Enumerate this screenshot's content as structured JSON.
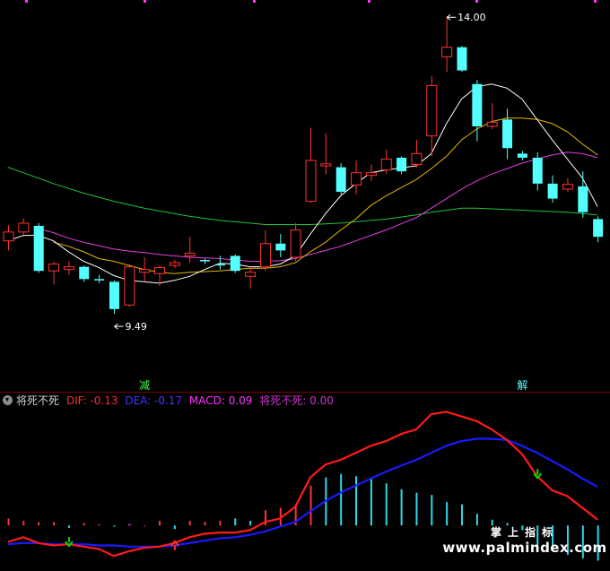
{
  "colors": {
    "background": "#000000",
    "up_candle": "#ff3333",
    "down_candle": "#54ffff",
    "ma_white": "#ffffff",
    "ma_yellow": "#e6b800",
    "ma_magenta": "#e040e0",
    "ma_green": "#1fc43a",
    "dif": "#ff1a1a",
    "dea": "#1a1aff",
    "macd_label": "#ff33ff",
    "signal_label": "#cc33cc",
    "hist_pos": "#ff3333",
    "hist_neg": "#30d8e8",
    "hist_mag": "#ff33ff",
    "arrow_green": "#00e000",
    "arrow_red": "#ff3333",
    "separator": "#7a0000",
    "top_ticks": "#ff33ff"
  },
  "chart_data": [
    {
      "type": "candlestick",
      "price_range": [
        8.6,
        14.2
      ],
      "candles": [
        {
          "o": 10.72,
          "h": 10.95,
          "l": 10.58,
          "c": 10.85
        },
        {
          "o": 10.85,
          "h": 11.05,
          "l": 10.78,
          "c": 10.98
        },
        {
          "o": 10.94,
          "h": 10.98,
          "l": 10.25,
          "c": 10.28
        },
        {
          "o": 10.28,
          "h": 10.42,
          "l": 10.08,
          "c": 10.38
        },
        {
          "o": 10.3,
          "h": 10.42,
          "l": 10.22,
          "c": 10.34
        },
        {
          "o": 10.34,
          "h": 10.36,
          "l": 10.12,
          "c": 10.16
        },
        {
          "o": 10.16,
          "h": 10.22,
          "l": 10.1,
          "c": 10.14
        },
        {
          "o": 10.12,
          "h": 10.14,
          "l": 9.65,
          "c": 9.72
        },
        {
          "o": 9.78,
          "h": 10.38,
          "l": 9.75,
          "c": 10.34
        },
        {
          "o": 10.26,
          "h": 10.48,
          "l": 10.12,
          "c": 10.3
        },
        {
          "o": 10.24,
          "h": 10.36,
          "l": 10.06,
          "c": 10.33
        },
        {
          "o": 10.36,
          "h": 10.44,
          "l": 10.32,
          "c": 10.4
        },
        {
          "o": 10.5,
          "h": 10.78,
          "l": 10.4,
          "c": 10.54
        },
        {
          "o": 10.44,
          "h": 10.46,
          "l": 10.38,
          "c": 10.42
        },
        {
          "o": 10.38,
          "h": 10.5,
          "l": 10.3,
          "c": 10.36
        },
        {
          "o": 10.5,
          "h": 10.52,
          "l": 10.25,
          "c": 10.28
        },
        {
          "o": 10.2,
          "h": 10.34,
          "l": 10.02,
          "c": 10.26
        },
        {
          "o": 10.34,
          "h": 10.88,
          "l": 10.28,
          "c": 10.68
        },
        {
          "o": 10.68,
          "h": 10.82,
          "l": 10.48,
          "c": 10.58
        },
        {
          "o": 10.48,
          "h": 10.98,
          "l": 10.42,
          "c": 10.88
        },
        {
          "o": 11.3,
          "h": 12.38,
          "l": 11.28,
          "c": 11.9
        },
        {
          "o": 11.82,
          "h": 12.3,
          "l": 11.7,
          "c": 11.85
        },
        {
          "o": 11.8,
          "h": 11.86,
          "l": 11.4,
          "c": 11.44
        },
        {
          "o": 11.54,
          "h": 11.9,
          "l": 11.4,
          "c": 11.72
        },
        {
          "o": 11.68,
          "h": 11.84,
          "l": 11.6,
          "c": 11.72
        },
        {
          "o": 11.76,
          "h": 12.06,
          "l": 11.7,
          "c": 11.92
        },
        {
          "o": 11.94,
          "h": 11.96,
          "l": 11.7,
          "c": 11.74
        },
        {
          "o": 11.84,
          "h": 12.2,
          "l": 11.8,
          "c": 12.0
        },
        {
          "o": 12.26,
          "h": 13.14,
          "l": 11.96,
          "c": 13.0
        },
        {
          "o": 13.42,
          "h": 14.0,
          "l": 13.2,
          "c": 13.56
        },
        {
          "o": 13.56,
          "h": 13.58,
          "l": 13.2,
          "c": 13.22
        },
        {
          "o": 13.02,
          "h": 13.08,
          "l": 12.18,
          "c": 12.4
        },
        {
          "o": 12.4,
          "h": 12.74,
          "l": 12.36,
          "c": 12.46
        },
        {
          "o": 12.5,
          "h": 12.66,
          "l": 11.92,
          "c": 12.08
        },
        {
          "o": 12.0,
          "h": 12.04,
          "l": 11.9,
          "c": 11.94
        },
        {
          "o": 11.94,
          "h": 12.02,
          "l": 11.46,
          "c": 11.56
        },
        {
          "o": 11.56,
          "h": 11.68,
          "l": 11.28,
          "c": 11.34
        },
        {
          "o": 11.48,
          "h": 11.64,
          "l": 11.44,
          "c": 11.55
        },
        {
          "o": 11.52,
          "h": 11.74,
          "l": 11.06,
          "c": 11.14
        },
        {
          "o": 11.04,
          "h": 11.08,
          "l": 10.7,
          "c": 10.78
        }
      ],
      "ma_white": [
        10.72,
        10.8,
        10.8,
        10.72,
        10.56,
        10.42,
        10.33,
        10.21,
        10.14,
        10.12,
        10.1,
        10.14,
        10.2,
        10.3,
        10.39,
        10.38,
        10.34,
        10.34,
        10.38,
        10.5,
        10.82,
        11.12,
        11.38,
        11.56,
        11.72,
        11.76,
        11.79,
        11.82,
        12.0,
        12.44,
        12.8,
        12.98,
        13.02,
        12.96,
        12.8,
        12.5,
        12.2,
        11.92,
        11.64,
        11.22
      ],
      "ma_yellow": [
        null,
        null,
        null,
        10.7,
        10.64,
        10.56,
        10.46,
        10.42,
        10.36,
        10.3,
        10.26,
        10.24,
        10.26,
        10.27,
        10.28,
        10.3,
        10.32,
        10.32,
        10.34,
        10.4,
        10.56,
        10.7,
        10.88,
        11.04,
        11.24,
        11.38,
        11.5,
        11.62,
        11.78,
        11.96,
        12.2,
        12.36,
        12.47,
        12.52,
        12.52,
        12.5,
        12.44,
        12.32,
        12.14,
        11.98
      ],
      "ma_magenta": [
        null,
        null,
        10.9,
        10.84,
        10.76,
        10.7,
        10.65,
        10.6,
        10.57,
        10.55,
        10.52,
        10.5,
        10.48,
        10.47,
        10.46,
        10.44,
        10.42,
        10.42,
        10.43,
        10.46,
        10.52,
        10.58,
        10.64,
        10.72,
        10.8,
        10.88,
        10.97,
        11.06,
        11.2,
        11.34,
        11.48,
        11.6,
        11.7,
        11.78,
        11.86,
        11.92,
        11.98,
        12.02,
        12.0,
        11.94
      ],
      "ma_green": [
        11.8,
        11.72,
        11.64,
        11.56,
        11.49,
        11.42,
        11.36,
        11.3,
        11.25,
        11.2,
        11.16,
        11.12,
        11.08,
        11.05,
        11.02,
        11.0,
        10.98,
        10.96,
        10.96,
        10.96,
        10.96,
        10.97,
        10.98,
        11.0,
        11.02,
        11.04,
        11.07,
        11.1,
        11.14,
        11.17,
        11.2,
        11.2,
        11.19,
        11.18,
        11.17,
        11.16,
        11.15,
        11.14,
        11.12,
        11.1
      ],
      "high_marker": {
        "index": 29,
        "label": "14.00"
      },
      "low_marker": {
        "index": 7,
        "label": "9.49"
      },
      "signals": [
        {
          "index": 9,
          "label": "减",
          "color": "#40ff40"
        },
        {
          "index": 34,
          "label": "解",
          "color": "#54ffff"
        }
      ]
    },
    {
      "type": "macd",
      "value_range": [
        -0.35,
        0.95
      ],
      "indicator_name": "将死不死",
      "dif_label": "DIF: -0.13",
      "dea_label": "DEA: -0.17",
      "macd_label": "MACD: 0.09",
      "signal_label": "将死不死: 0.00",
      "dif": [
        -0.14,
        -0.1,
        -0.15,
        -0.17,
        -0.16,
        -0.18,
        -0.2,
        -0.26,
        -0.22,
        -0.19,
        -0.18,
        -0.15,
        -0.1,
        -0.07,
        -0.06,
        -0.06,
        -0.04,
        0.03,
        0.06,
        0.16,
        0.41,
        0.52,
        0.56,
        0.62,
        0.68,
        0.72,
        0.78,
        0.82,
        0.95,
        0.97,
        0.93,
        0.89,
        0.82,
        0.73,
        0.61,
        0.42,
        0.3,
        0.25,
        0.15,
        0.05
      ],
      "dea": [
        -0.16,
        -0.15,
        -0.15,
        -0.16,
        -0.16,
        -0.16,
        -0.17,
        -0.17,
        -0.18,
        -0.18,
        -0.18,
        -0.17,
        -0.15,
        -0.13,
        -0.11,
        -0.1,
        -0.08,
        -0.05,
        -0.01,
        0.03,
        0.12,
        0.21,
        0.28,
        0.34,
        0.4,
        0.46,
        0.51,
        0.56,
        0.62,
        0.68,
        0.72,
        0.74,
        0.74,
        0.73,
        0.68,
        0.62,
        0.55,
        0.48,
        0.4,
        0.33
      ],
      "histogram": [
        0.06,
        0.04,
        0.03,
        0.03,
        -0.02,
        0.02,
        0.01,
        -0.01,
        0.01,
        0.0,
        0.04,
        -0.03,
        0.04,
        0.03,
        0.04,
        0.06,
        0.04,
        0.13,
        0.15,
        0.18,
        0.34,
        0.41,
        0.44,
        0.42,
        0.4,
        0.36,
        0.31,
        0.28,
        0.26,
        0.2,
        0.18,
        0.1,
        0.05,
        0.02,
        -0.04,
        -0.2,
        -0.22,
        -0.25,
        -0.28,
        -0.3
      ],
      "histogram_colors": [
        "pos",
        "pos",
        "pos",
        "pos",
        "neg",
        "pos",
        "pos",
        "neg",
        "mag",
        "pos",
        "pos",
        "neg",
        "pos",
        "pos",
        "pos",
        "neg",
        "neg",
        "pos",
        "pos",
        "pos",
        "pos",
        "neg",
        "neg",
        "neg",
        "neg",
        "neg",
        "neg",
        "neg",
        "neg",
        "neg",
        "neg",
        "neg",
        "neg",
        "neg",
        "neg",
        "neg",
        "neg",
        "neg",
        "neg",
        "neg"
      ],
      "arrows": [
        {
          "index": 4,
          "dir": "down",
          "color": "green"
        },
        {
          "index": 11,
          "dir": "up",
          "color": "red"
        },
        {
          "index": 35,
          "dir": "down",
          "color": "green"
        }
      ]
    }
  ],
  "watermark": {
    "cn": "掌上指标",
    "url": "www.palmindex.com"
  }
}
